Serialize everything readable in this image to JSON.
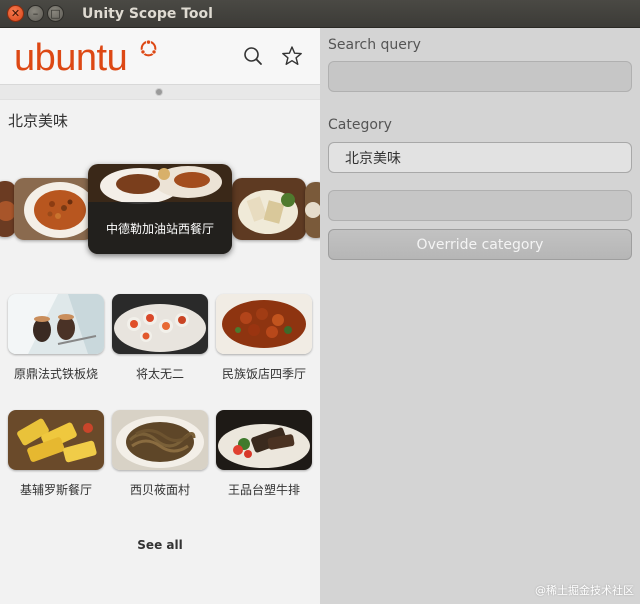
{
  "window": {
    "title": "Unity Scope Tool"
  },
  "scope": {
    "logo_text": "ubuntu",
    "category_title": "北京美味",
    "carousel": {
      "featured_label": "中德勒加油站西餐厅"
    },
    "grid": [
      {
        "label": "原鼎法式铁板烧"
      },
      {
        "label": "将太无二"
      },
      {
        "label": "民族饭店四季厅"
      },
      {
        "label": "基辅罗斯餐厅"
      },
      {
        "label": "西贝莜面村"
      },
      {
        "label": "王品台塑牛排"
      }
    ],
    "see_all": "See all"
  },
  "panel": {
    "search_label": "Search query",
    "search_value": "",
    "category_label": "Category",
    "category_value": "北京美味",
    "category_extra": "",
    "override_button": "Override category"
  },
  "footer": {
    "watermark": "@稀土掘金技术社区"
  },
  "colors": {
    "ubuntu_orange": "#dd4814",
    "titlebar": "#3c3b37",
    "close_button": "#e9592d"
  },
  "icons": {
    "search": "search-icon",
    "favorite": "star-icon",
    "close": "close-icon",
    "minimize": "minimize-icon",
    "maximize": "maximize-icon"
  }
}
